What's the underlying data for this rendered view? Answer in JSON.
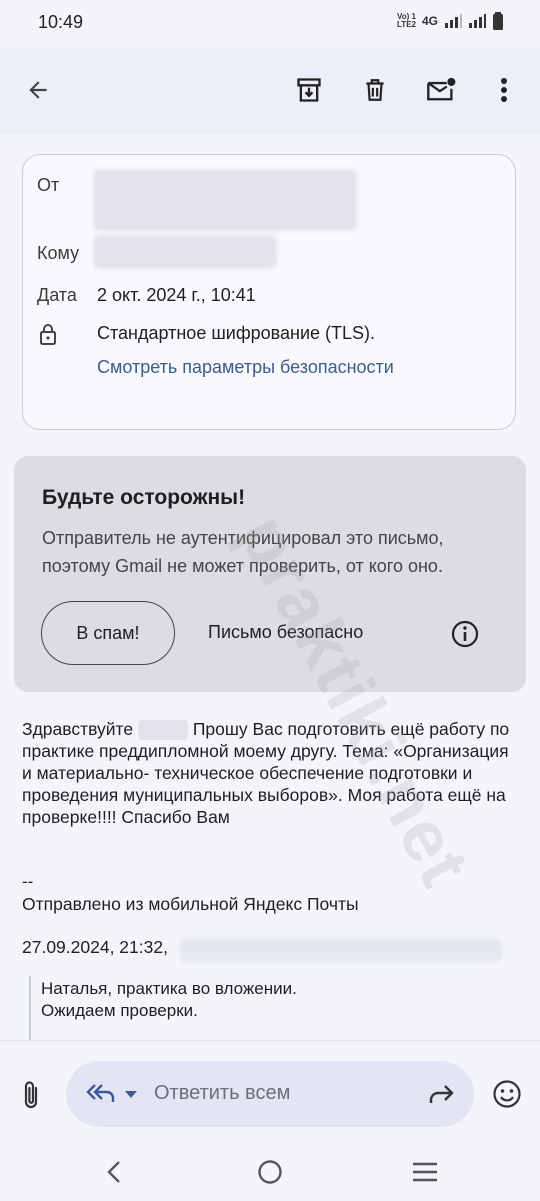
{
  "status": {
    "time": "10:49",
    "volte": "VoLTE2",
    "network": "4G"
  },
  "toolbar": {
    "back": "arrow-back-icon",
    "archive": "archive-icon",
    "delete": "trash-icon",
    "mark_unread": "mail-unread-icon",
    "more": "more-vert-icon"
  },
  "details": {
    "from_label": "От",
    "to_label": "Кому",
    "date_label": "Дата",
    "date_value": "2 окт. 2024 г., 10:41",
    "encryption": "Стандартное шифрование (TLS).",
    "security_link": "Смотреть параметры безопасности"
  },
  "warning": {
    "title": "Будьте осторожны!",
    "text": "Отправитель не аутентифицировал это письмо, поэтому Gmail не может проверить, от кого оно.",
    "spam_button": "В спам!",
    "safe_button": "Письмо безопасно"
  },
  "message": {
    "greeting": "Здравствуйте",
    "body_after_name": " Прошу Вас подготовить ещё работу по практике преддипломной моему другу. Тема: «Организация  и материально- техническое обеспечение подготовки и проведения муниципальных выборов».  Моя работа ещё на проверке!!!! Спасибо Вам",
    "sig_separator": "--",
    "signature": "Отправлено из мобильной Яндекс Почты",
    "quote_header": "27.09.2024, 21:32,",
    "quote_line1": "Наталья, практика во вложении.",
    "quote_line2": "Ожидаем проверки."
  },
  "reply": {
    "placeholder": "Ответить всем"
  },
  "watermark": "praktiki.net",
  "colors": {
    "accent_link": "#3b5d8a",
    "warning_bg": "#dcdde2",
    "topbar_bg": "#eceef9"
  }
}
